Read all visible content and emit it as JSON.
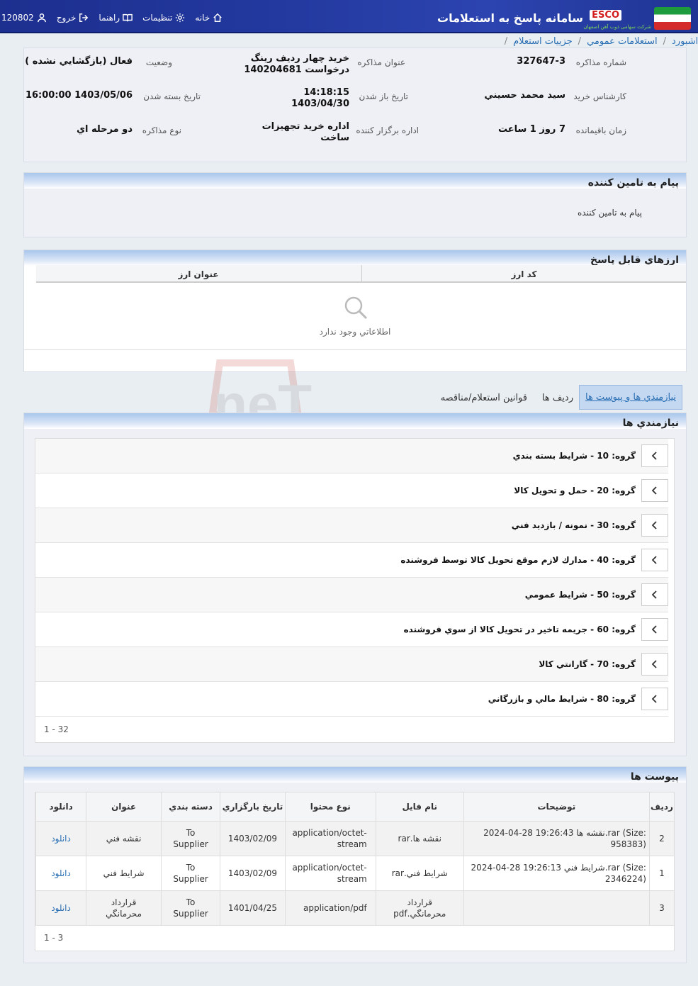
{
  "header": {
    "title": "سامانه پاسخ به استعلامات",
    "brand": "ESCO",
    "brand_sub": "شرکت سهامی ذوب آهن اصفهان",
    "nav": {
      "home": "خانه",
      "settings": "تنظیمات",
      "guide": "راهنما",
      "logout": "خروج",
      "user": "120802"
    }
  },
  "breadcrumb": [
    "داشبورد",
    "استعلامات عمومي",
    "جزييات استعلام"
  ],
  "info": {
    "number_label": "شماره مذاكره",
    "number": "327647-3",
    "subject_label": "عنوان مذاكره",
    "subject_l1": "خريد چهار رديف رينگ",
    "subject_l2": "درخواست 140204681",
    "status_label": "وضعيت",
    "status": "فعال (بازگشايي نشده )",
    "expert_label": "كارشناس خريد",
    "expert": "سيد محمد حسيني",
    "open_label": "تاريخ باز شدن",
    "open_time": "14:18:15",
    "open_date": "1403/04/30",
    "close_label": "تاريخ بسته شدن",
    "close": "1403/05/06 16:00:00",
    "remain_label": "زمان باقيمانده",
    "remain": "7 روز 1 ساعت",
    "dept_label": "اداره برگزار كننده",
    "dept_l1": "اداره خريد تجهيزات",
    "dept_l2": "ساخت",
    "type_label": "نوع مذاكره",
    "type": "دو مرحله اي"
  },
  "message": {
    "title": "پيام به تامين كننده",
    "body": "پيام به تامين كننده"
  },
  "currency": {
    "title": "ارزهاي قابل پاسخ",
    "col_code": "كد ارز",
    "col_title": "عنوان ارز",
    "empty": "اطلاعاتي وجود ندارد"
  },
  "tabs": {
    "active": "نيازمندي ها و پيوست ها",
    "rows": "رديف ها",
    "rules": "قوانين استعلام/مناقصه"
  },
  "requirements": {
    "title": "نيازمندي ها",
    "groups": [
      "گروه: 10 - شرايط بسته بندي",
      "گروه: 20 - حمل و تحويل كالا",
      "گروه: 30 - نمونه / بازديد فني",
      "گروه: 40 - مدارك لازم موقع تحويل كالا توسط فروشنده",
      "گروه: 50 - شرايط عمومي",
      "گروه: 60 - جريمه تاخير در تحويل كالا از سوي فروشنده",
      "گروه: 70 - گارانتي كالا",
      "گروه: 80 - شرايط مالي و بازرگاني"
    ],
    "pager": "1 - 32"
  },
  "attachments": {
    "title": "پيوست ها",
    "cols": [
      "رديف",
      "توضيحات",
      "نام فايل",
      "نوع محتوا",
      "تاريخ بارگزاري",
      "دسته بندي",
      "عنوان",
      "دانلود"
    ],
    "rows": [
      {
        "n": "2",
        "desc_l1": "2024-04-28 19:26:43 نقشه ها.rar (Size:",
        "desc_l2": "958383)",
        "file": "نقشه ها.rar",
        "type_l1": "application/octet-",
        "type_l2": "stream",
        "date": "1403/02/09",
        "cat_l1": "To",
        "cat_l2": "Supplier",
        "title": "نقشه فني",
        "dl": "دانلود"
      },
      {
        "n": "1",
        "desc_l1": "2024-04-28 19:26:13 شرايط فني.rar (Size:",
        "desc_l2": "2346224)",
        "file": "شرايط فني.rar",
        "type_l1": "application/octet-",
        "type_l2": "stream",
        "date": "1403/02/09",
        "cat_l1": "To",
        "cat_l2": "Supplier",
        "title": "شرايط فني",
        "dl": "دانلود"
      },
      {
        "n": "3",
        "desc_l1": "",
        "desc_l2": "",
        "file": "قرارداد محرمانگي.pdf",
        "type_l1": "application/pdf",
        "type_l2": "",
        "date": "1401/04/25",
        "cat_l1": "To",
        "cat_l2": "Supplier",
        "title": "قرارداد محرمانگي",
        "dl": "دانلود"
      }
    ],
    "pager": "1 - 3"
  },
  "watermark": "AriaTender.neT",
  "colors": {
    "topbar": "#23399f",
    "link": "#2a6fb3",
    "header_blue": "#a9c6ec"
  }
}
